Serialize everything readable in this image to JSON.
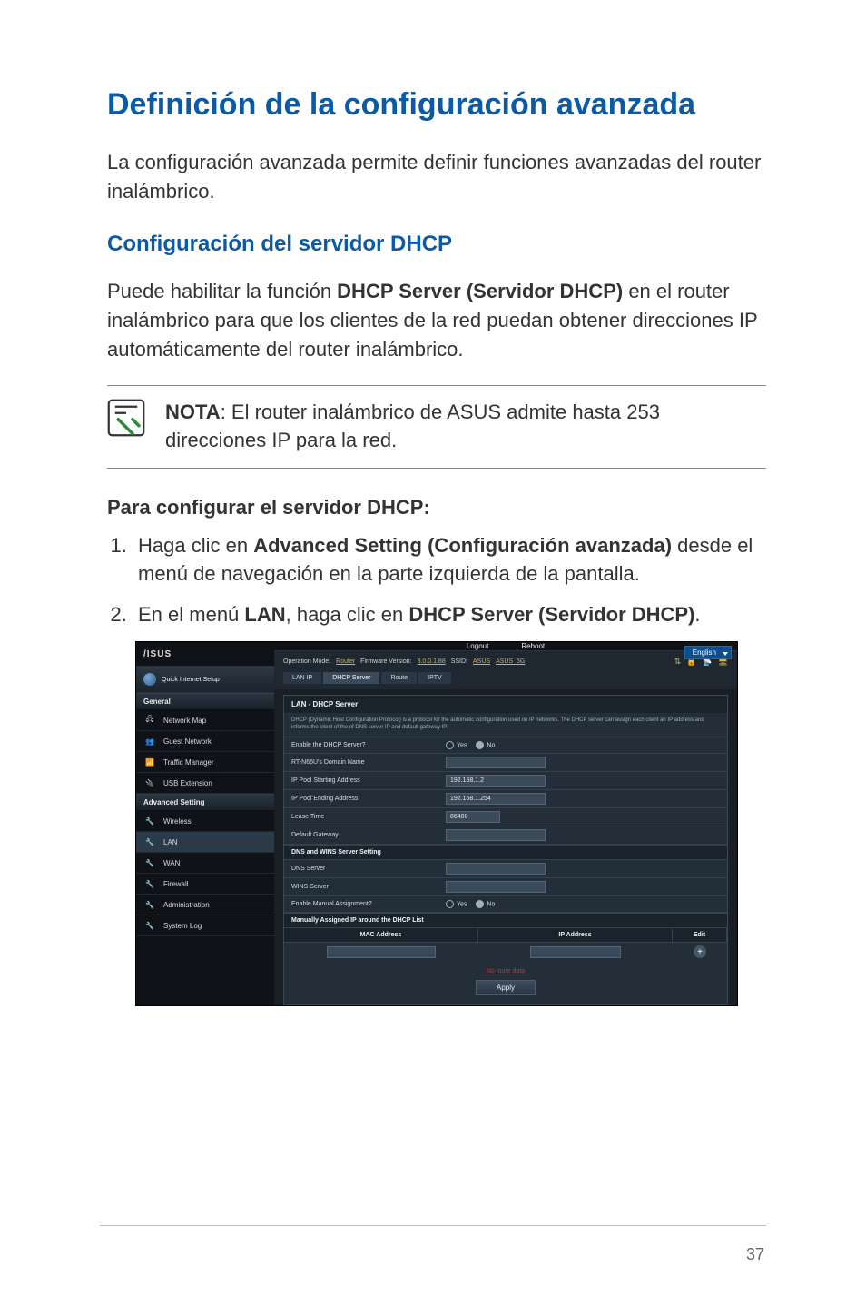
{
  "title": "Definición de la configuración avanzada",
  "intro": "La configuración avanzada permite definir funciones avanzadas del router inalámbrico.",
  "section_title": "Configuración del servidor DHCP",
  "para_pre": "Puede habilitar la función ",
  "para_bold": "DHCP Server (Servidor DHCP)",
  "para_post": " en el router inalámbrico para que los clientes de la red puedan obtener direcciones IP automáticamente del router inalámbrico.",
  "note_label": "NOTA",
  "note_text": ":    El router inalámbrico de ASUS admite hasta 253 direcciones IP para la red.",
  "steps_title": "Para configurar el servidor DHCP:",
  "steps": [
    {
      "pre": "Haga clic en ",
      "bold": "Advanced Setting (Configuración avanzada)",
      "post": " desde el menú de navegación en la parte izquierda de la pantalla."
    },
    {
      "pre": "En el menú ",
      "bold": "LAN",
      "mid": ", haga clic en ",
      "bold2": "DHCP Server (Servidor DHCP)",
      "post": "."
    }
  ],
  "page_number": "37",
  "ui": {
    "brand": "/ISUS",
    "top": {
      "logout": "Logout",
      "reboot": "Reboot",
      "language": "English"
    },
    "qis": "Quick Internet Setup",
    "section_general": "General",
    "nav_general": [
      "Network Map",
      "Guest Network",
      "Traffic Manager",
      "USB Extension"
    ],
    "section_advanced": "Advanced Setting",
    "nav_advanced": [
      "Wireless",
      "LAN",
      "WAN",
      "Firewall",
      "Administration",
      "System Log"
    ],
    "info": {
      "op_mode_label": "Operation Mode:",
      "op_mode": "Router",
      "fw_label": "Firmware Version:",
      "fw": "3.0.0.1.88",
      "ssid_label": "SSID:",
      "ssid1": "ASUS",
      "ssid2": "ASUS_5G"
    },
    "tabs": [
      "LAN IP",
      "DHCP Server",
      "Route",
      "IPTV"
    ],
    "panel_title": "LAN - DHCP Server",
    "panel_desc": "DHCP (Dynamic Host Configuration Protocol) is a protocol for the automatic configuration used on IP networks. The DHCP server can assign each client an IP address and informs the client of the of DNS server IP and default gateway IP.",
    "rows": {
      "enable": "Enable the DHCP Server?",
      "domain": "RT-N66U's Domain Name",
      "pool_start": "IP Pool Starting Address",
      "pool_end": "IP Pool Ending Address",
      "lease": "Lease Time",
      "gateway": "Default Gateway"
    },
    "values": {
      "pool_start": "192.168.1.2",
      "pool_end": "192.168.1.254",
      "lease": "86400"
    },
    "radio_yes": "Yes",
    "radio_no": "No",
    "sub_dns": "DNS and WINS Server Setting",
    "rows2": {
      "dns": "DNS Server",
      "wins": "WINS Server",
      "manual": "Enable Manual Assignment?"
    },
    "sub_manual": "Manually Assigned IP around the DHCP List",
    "table": {
      "mac": "MAC Address",
      "ip": "IP Address",
      "edit": "Edit"
    },
    "nomore": "No more data",
    "apply": "Apply"
  }
}
